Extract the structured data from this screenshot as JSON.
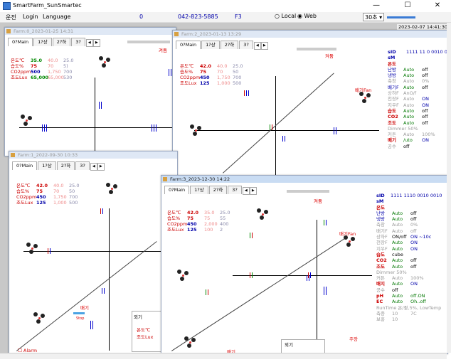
{
  "app": {
    "title": "SmartFarm_SunSmartec",
    "minimize": "—",
    "maximize": "☐",
    "close": "✕"
  },
  "menu": {
    "items": [
      "운전",
      "Login",
      "Language"
    ],
    "counter": "0",
    "phone": "042-823-5885",
    "key": "F3",
    "local": "Local",
    "web": "Web",
    "interval": "30초",
    "datetime": "2023-02-07 14:41:30"
  },
  "windows": [
    {
      "id": "farm0",
      "title": "Farm:0_2023-01-25 14:31",
      "tabs": [
        "0?Main",
        "1?상",
        "2?하",
        "3?"
      ]
    },
    {
      "id": "farm2",
      "title": "Farm:2_2023-01-13 13:29",
      "tabs": [
        "0?Main",
        "1?상",
        "2?하",
        "3?"
      ]
    },
    {
      "id": "farm1",
      "title": "Farm:1_2022-09-30 10:33",
      "tabs": [
        "0?Main",
        "1?상",
        "2?하",
        "3?"
      ]
    },
    {
      "id": "farm3",
      "title": "Farm:3_2023-12-30 14:22",
      "tabs": [
        "0?Main",
        "1?상",
        "2?하",
        "3?"
      ]
    }
  ],
  "stats_labels": {
    "temp": "온도℃",
    "humid": "습도%",
    "co2": "CO2ppm",
    "lux": "조도Lux"
  },
  "farm0_stats": [
    [
      "35.0",
      "40.0",
      "25.0"
    ],
    [
      "75",
      "70",
      "5)"
    ],
    [
      "500",
      "1,750",
      "700"
    ],
    [
      "65,000",
      "65,000",
      "530"
    ]
  ],
  "farm2_stats": [
    [
      "42.0",
      "40.0",
      "25.0"
    ],
    [
      "75",
      "70",
      "50"
    ],
    [
      "450",
      "1,750",
      "700"
    ],
    [
      "125",
      "1,000",
      "500"
    ]
  ],
  "farm1_stats": [
    [
      "42.0",
      "40.0",
      "25.0"
    ],
    [
      "75",
      "70",
      "50"
    ],
    [
      "450",
      "1,750",
      "700"
    ],
    [
      "125",
      "1,000",
      "500"
    ]
  ],
  "farm3_stats": [
    [
      "42.0",
      "35.0",
      "25.0"
    ],
    [
      "75",
      "75",
      "55"
    ],
    [
      "450",
      "2,000",
      "400"
    ],
    [
      "125",
      "100",
      "2"
    ]
  ],
  "labels": {
    "keo": "켜둠",
    "fan": "배기Fan",
    "stop": "Stop",
    "baegi": "배기",
    "alarm": "Alarm",
    "wigi": "외기",
    "temp_c": "온도℃",
    "lux_lbl": "조도Lux",
    "wigi2": "외기",
    "ju": "주장"
  },
  "farm2_panel": {
    "sid": "sID",
    "sid_val": "1111 11 0 0010 001",
    "sm": "sM",
    "onn": "온도",
    "rows1": [
      [
        "난방",
        "Auto",
        "off"
      ],
      [
        "냉방",
        "Auto",
        "off"
      ],
      [
        "축창",
        "Auto",
        "0%"
      ],
      [
        "배기F",
        "Auto",
        "off"
      ],
      [
        "상하F",
        "AnO/f",
        ""
      ],
      [
        "천장F",
        "Auto",
        "ON"
      ],
      [
        "지우F",
        "Auto",
        "ON"
      ]
    ],
    "humid": "습도",
    "humid_row": [
      "Auto",
      "off"
    ],
    "co2": "CO2",
    "co2_row": [
      "Auto",
      "off"
    ],
    "lux": "조도",
    "lux_row": [
      "Auto",
      "off"
    ],
    "dimmer": "Dimmer 50%",
    "curtain": [
      "커튼",
      "Auto",
      "100%"
    ],
    "baegi": "배기",
    "baegi_row": [
      "/uto",
      "ON"
    ],
    "gong": "공수",
    "gong_val": "off"
  },
  "farm3_panel": {
    "sid": "sID",
    "sid_val": "1111 1110 0010 0010",
    "sm": "sM",
    "onn": "온도",
    "rows1": [
      [
        "난방",
        "Auto",
        "off"
      ],
      [
        "냉방",
        "Auto",
        "off"
      ],
      [
        "축창",
        "Auto",
        "0%"
      ],
      [
        "배기F",
        "Auto",
        "off"
      ],
      [
        "상하F",
        "ON/off",
        "ON  ~10c"
      ],
      [
        "천장F",
        "Auto",
        "ON"
      ],
      [
        "지우F",
        "Auto",
        "ON"
      ]
    ],
    "humid": "습도",
    "humid_row": [
      "cube",
      ""
    ],
    "co2": "CO2",
    "co2_row": [
      "Auto",
      "off"
    ],
    "lux": "조도",
    "lux_row": [
      "Auto",
      "off"
    ],
    "dimmer": "Dimmer 50%",
    "curtain": [
      "커튼",
      "Auto",
      "100%"
    ],
    "baegi": "배지",
    "baegi_row": [
      "Auto",
      "ON"
    ],
    "gong": "공수",
    "gong_val": "off",
    "ph": "pH",
    "ph_row": [
      "Auto",
      "off.ON"
    ],
    "ec": "EC",
    "ec_row": [
      "Auto",
      "Oh..off"
    ],
    "runtime": "RunTime 온/퓥,5%, LowTemp",
    "rt1": [
      "축중",
      "10",
      "7C"
    ],
    "rt2": [
      "보홍",
      "10",
      ""
    ]
  }
}
